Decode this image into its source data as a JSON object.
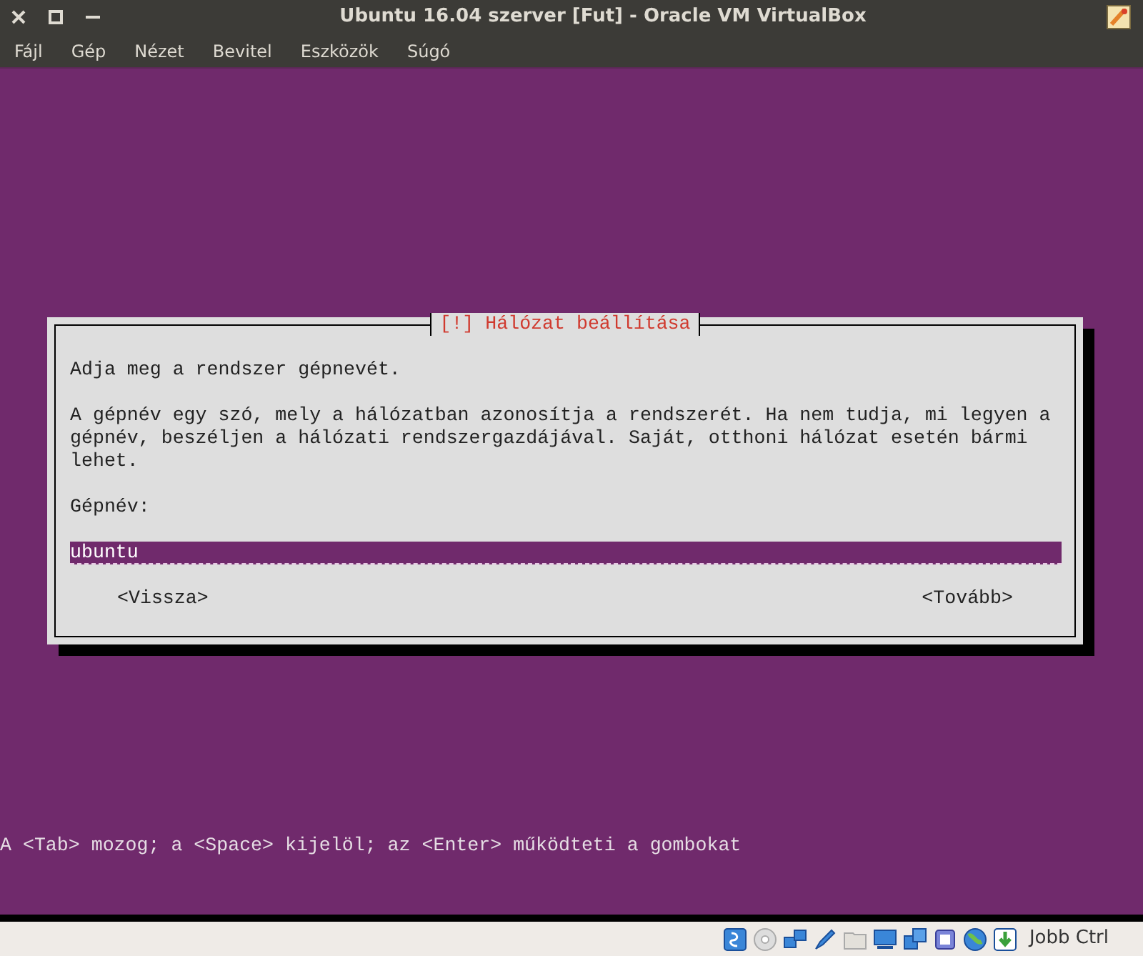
{
  "window": {
    "title": "Ubuntu 16.04 szerver [Fut] - Oracle VM VirtualBox"
  },
  "menu": [
    "Fájl",
    "Gép",
    "Nézet",
    "Bevitel",
    "Eszközök",
    "Súgó"
  ],
  "dialog": {
    "title": "[!] Hálózat beállítása",
    "prompt": "Adja meg a rendszer gépnevét.",
    "description": "A gépnév egy szó, mely a hálózatban azonosítja a rendszerét. Ha nem tudja, mi legyen a gépnév, beszéljen a hálózati rendszergazdájával. Saját, otthoni hálózat esetén bármi lehet.",
    "field_label": "Gépnév:",
    "field_value": "ubuntu",
    "buttons": [
      "<Vissza>",
      "<Tovább>"
    ]
  },
  "hint": "A <Tab> mozog; a <Space> kijelöl; az <Enter> működteti a gombokat",
  "status_bar": {
    "host_key": "Jobb Ctrl"
  }
}
